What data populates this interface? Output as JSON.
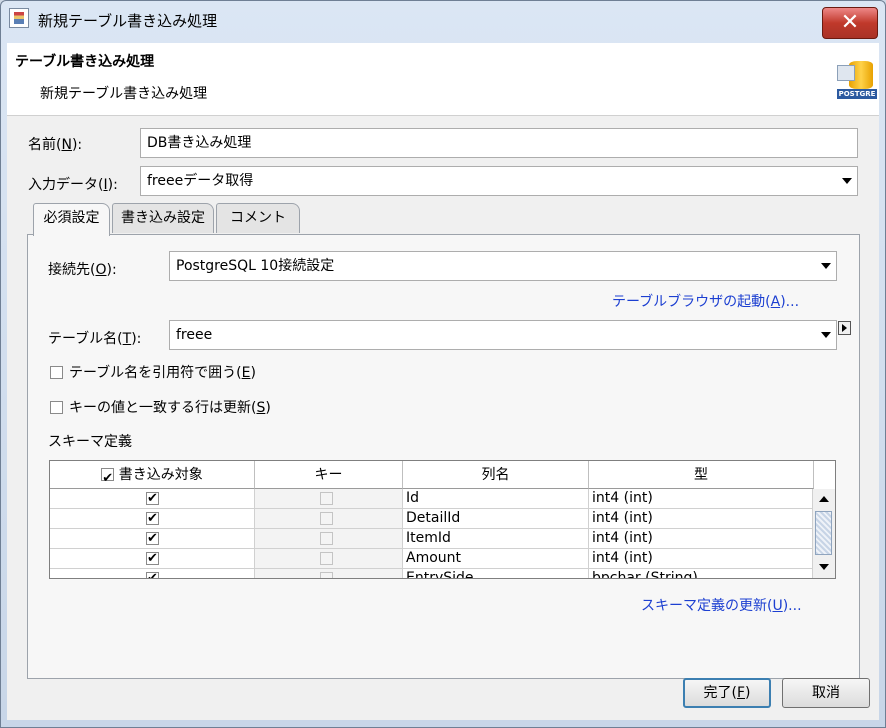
{
  "window": {
    "title": "新規テーブル書き込み処理",
    "close_label": "✕"
  },
  "header": {
    "title": "テーブル書き込み処理",
    "subtitle": "新規テーブル書き込み処理",
    "icon_badge": "POSTGRE"
  },
  "form": {
    "name_label": "名前(",
    "name_key": "N",
    "name_suffix": "):",
    "name_value": "DB書き込み処理",
    "input_label": "入力データ(",
    "input_key": "I",
    "input_suffix": "):",
    "input_value": "freeeデータ取得"
  },
  "tabs": [
    {
      "label": "必須設定"
    },
    {
      "label": "書き込み設定"
    },
    {
      "label": "コメント"
    }
  ],
  "required": {
    "conn_label": "接続先(",
    "conn_key": "O",
    "conn_suffix": "):",
    "conn_value": "PostgreSQL 10接続設定",
    "browser_link_pre": "テーブルブラウザの起動(",
    "browser_link_key": "A",
    "browser_link_post": ")...",
    "table_label": "テーブル名(",
    "table_key": "T",
    "table_suffix": "):",
    "table_value": "freee",
    "quote_label": "テーブル名を引用符で囲う(",
    "quote_key": "E",
    "quote_suffix": ")",
    "update_label": "キーの値と一致する行は更新(",
    "update_key": "S",
    "update_suffix": ")",
    "schema_label": "スキーマ定義",
    "schema_link_pre": "スキーマ定義の更新(",
    "schema_link_key": "U",
    "schema_link_post": ")..."
  },
  "grid": {
    "headers": [
      "書き込み対象",
      "キー",
      "列名",
      "型"
    ],
    "rows": [
      {
        "target": true,
        "key": false,
        "name": "Id",
        "type": "int4 (int)"
      },
      {
        "target": true,
        "key": false,
        "name": "DetailId",
        "type": "int4 (int)"
      },
      {
        "target": true,
        "key": false,
        "name": "ItemId",
        "type": "int4 (int)"
      },
      {
        "target": true,
        "key": false,
        "name": "Amount",
        "type": "int4 (int)"
      },
      {
        "target": true,
        "key": false,
        "name": "EntrySide",
        "type": "bpchar (String)"
      }
    ]
  },
  "footer": {
    "ok_pre": "完了(",
    "ok_key": "F",
    "ok_post": ")",
    "cancel_label": "取消"
  }
}
